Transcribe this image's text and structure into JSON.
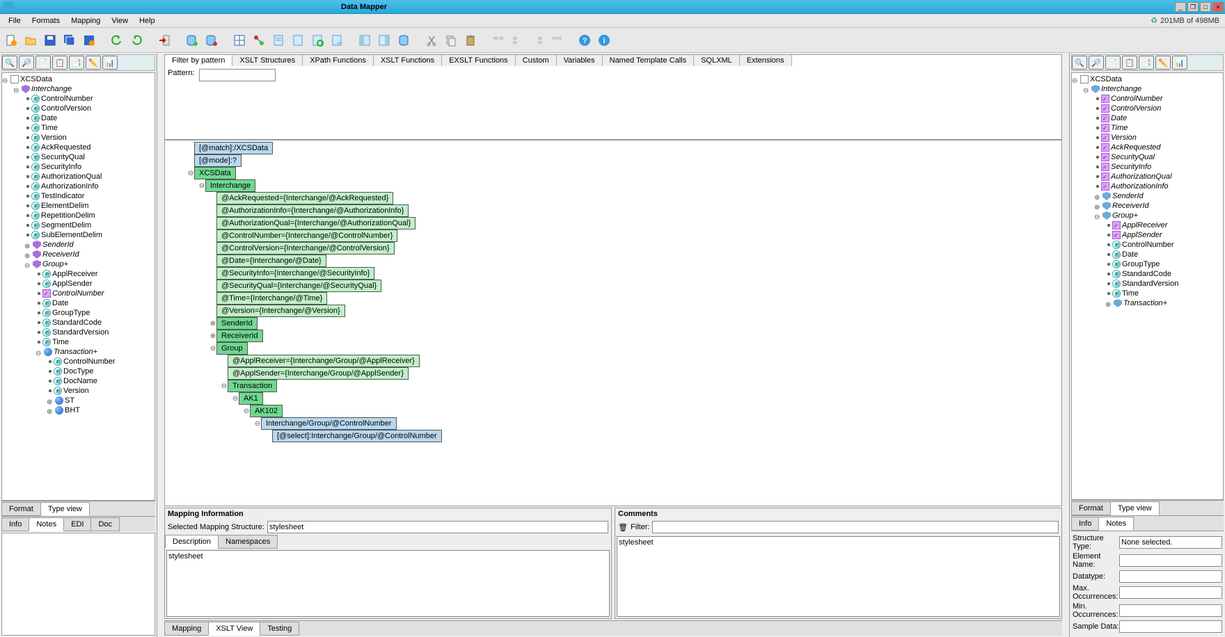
{
  "app": {
    "title": "Data Mapper",
    "memory": "201MB of 498MB"
  },
  "menu": {
    "file": "File",
    "formats": "Formats",
    "mapping": "Mapping",
    "view": "View",
    "help": "Help"
  },
  "left_tabs": {
    "format": "Format",
    "typeview": "Type view",
    "info": "Info",
    "notes": "Notes",
    "edi": "EDI",
    "doc": "Doc"
  },
  "left_tree": [
    {
      "ind": 0,
      "ex": "open",
      "ico": "doc",
      "label": "XCSData"
    },
    {
      "ind": 1,
      "ex": "open",
      "ico": "shield",
      "label": "Interchange",
      "italic": true
    },
    {
      "ind": 2,
      "ex": "dot",
      "ico": "at",
      "label": "ControlNumber"
    },
    {
      "ind": 2,
      "ex": "dot",
      "ico": "at",
      "label": "ControlVersion"
    },
    {
      "ind": 2,
      "ex": "dot",
      "ico": "at",
      "label": "Date"
    },
    {
      "ind": 2,
      "ex": "dot",
      "ico": "at",
      "label": "Time"
    },
    {
      "ind": 2,
      "ex": "dot",
      "ico": "at",
      "label": "Version"
    },
    {
      "ind": 2,
      "ex": "dot",
      "ico": "at",
      "label": "AckRequested"
    },
    {
      "ind": 2,
      "ex": "dot",
      "ico": "at",
      "label": "SecurityQual"
    },
    {
      "ind": 2,
      "ex": "dot",
      "ico": "at",
      "label": "SecurityInfo"
    },
    {
      "ind": 2,
      "ex": "dot",
      "ico": "at",
      "label": "AuthorizationQual"
    },
    {
      "ind": 2,
      "ex": "dot",
      "ico": "at",
      "label": "AuthorizationInfo"
    },
    {
      "ind": 2,
      "ex": "dot",
      "ico": "at",
      "label": "TestIndicator"
    },
    {
      "ind": 2,
      "ex": "dot",
      "ico": "at",
      "label": "ElementDelim"
    },
    {
      "ind": 2,
      "ex": "dot",
      "ico": "at",
      "label": "RepetitionDelim"
    },
    {
      "ind": 2,
      "ex": "dot",
      "ico": "at",
      "label": "SegmentDelim"
    },
    {
      "ind": 2,
      "ex": "dot",
      "ico": "at",
      "label": "SubElementDelim"
    },
    {
      "ind": 2,
      "ex": "closed",
      "ico": "shield",
      "label": "SenderId",
      "italic": true
    },
    {
      "ind": 2,
      "ex": "closed",
      "ico": "shield",
      "label": "ReceiverId",
      "italic": true
    },
    {
      "ind": 2,
      "ex": "open",
      "ico": "shield",
      "label": "Group+",
      "italic": true
    },
    {
      "ind": 3,
      "ex": "dot",
      "ico": "at",
      "label": "ApplReceiver"
    },
    {
      "ind": 3,
      "ex": "dot",
      "ico": "at",
      "label": "ApplSender"
    },
    {
      "ind": 3,
      "ex": "dot",
      "ico": "gv",
      "label": "ControlNumber",
      "italic": true
    },
    {
      "ind": 3,
      "ex": "dot",
      "ico": "at",
      "label": "Date"
    },
    {
      "ind": 3,
      "ex": "dot",
      "ico": "at",
      "label": "GroupType"
    },
    {
      "ind": 3,
      "ex": "dot",
      "ico": "at",
      "label": "StandardCode"
    },
    {
      "ind": 3,
      "ex": "dot",
      "ico": "at",
      "label": "StandardVersion"
    },
    {
      "ind": 3,
      "ex": "dot",
      "ico": "at",
      "label": "Time"
    },
    {
      "ind": 3,
      "ex": "open",
      "ico": "ball",
      "label": "Transaction+",
      "italic": true
    },
    {
      "ind": 4,
      "ex": "dot",
      "ico": "at",
      "label": "ControlNumber"
    },
    {
      "ind": 4,
      "ex": "dot",
      "ico": "at",
      "label": "DocType"
    },
    {
      "ind": 4,
      "ex": "dot",
      "ico": "at",
      "label": "DocName"
    },
    {
      "ind": 4,
      "ex": "dot",
      "ico": "at",
      "label": "Version"
    },
    {
      "ind": 4,
      "ex": "closed",
      "ico": "ball",
      "label": "ST"
    },
    {
      "ind": 4,
      "ex": "closed",
      "ico": "ball",
      "label": "BHT"
    }
  ],
  "center": {
    "filter_tabs": [
      "Filter by pattern",
      "XSLT Structures",
      "XPath Functions",
      "XSLT Functions",
      "EXSLT Functions",
      "Custom",
      "Variables",
      "Named Template Calls",
      "SQLXML",
      "Extensions"
    ],
    "pattern_label": "Pattern:",
    "map_rows": [
      {
        "ind": 2,
        "ex": "",
        "cls": "c-blue",
        "label": "[@match]:/XCSData"
      },
      {
        "ind": 2,
        "ex": "",
        "cls": "c-blue",
        "label": "[@mode]:?"
      },
      {
        "ind": 2,
        "ex": "open",
        "cls": "c-green",
        "label": "XCSData"
      },
      {
        "ind": 3,
        "ex": "open",
        "cls": "c-green",
        "label": "Interchange"
      },
      {
        "ind": 4,
        "ex": "",
        "cls": "c-lgreen",
        "label": "@AckRequested={Interchange/@AckRequested}"
      },
      {
        "ind": 4,
        "ex": "",
        "cls": "c-lgreen",
        "label": "@AuthorizationInfo={Interchange/@AuthorizationInfo}"
      },
      {
        "ind": 4,
        "ex": "",
        "cls": "c-lgreen",
        "label": "@AuthorizationQual={Interchange/@AuthorizationQual}"
      },
      {
        "ind": 4,
        "ex": "",
        "cls": "c-lgreen",
        "label": "@ControlNumber={Interchange/@ControlNumber}"
      },
      {
        "ind": 4,
        "ex": "",
        "cls": "c-lgreen",
        "label": "@ControlVersion={Interchange/@ControlVersion}"
      },
      {
        "ind": 4,
        "ex": "",
        "cls": "c-lgreen",
        "label": "@Date={Interchange/@Date}"
      },
      {
        "ind": 4,
        "ex": "",
        "cls": "c-lgreen",
        "label": "@SecurityInfo={Interchange/@SecurityInfo}"
      },
      {
        "ind": 4,
        "ex": "",
        "cls": "c-lgreen",
        "label": "@SecurityQual={Interchange/@SecurityQual}"
      },
      {
        "ind": 4,
        "ex": "",
        "cls": "c-lgreen",
        "label": "@Time={Interchange/@Time}"
      },
      {
        "ind": 4,
        "ex": "",
        "cls": "c-lgreen",
        "label": "@Version={Interchange/@Version}"
      },
      {
        "ind": 4,
        "ex": "closed",
        "cls": "c-green",
        "label": "SenderId"
      },
      {
        "ind": 4,
        "ex": "closed",
        "cls": "c-green",
        "label": "ReceiverId"
      },
      {
        "ind": 4,
        "ex": "open",
        "cls": "c-green",
        "label": "Group"
      },
      {
        "ind": 5,
        "ex": "",
        "cls": "c-lgreen",
        "label": "@ApplReceiver={Interchange/Group/@ApplReceiver}"
      },
      {
        "ind": 5,
        "ex": "",
        "cls": "c-lgreen",
        "label": "@ApplSender={Interchange/Group/@ApplSender}"
      },
      {
        "ind": 5,
        "ex": "open",
        "cls": "c-green",
        "label": "Transaction"
      },
      {
        "ind": 6,
        "ex": "open",
        "cls": "c-green",
        "label": "AK1"
      },
      {
        "ind": 7,
        "ex": "open",
        "cls": "c-green",
        "label": "AK102"
      },
      {
        "ind": 8,
        "ex": "open",
        "cls": "c-blue",
        "label": "Interchange/Group/@ControlNumber"
      },
      {
        "ind": 9,
        "ex": "",
        "cls": "c-blue",
        "label": "[@select]:Interchange/Group/@ControlNumber"
      }
    ],
    "mapping_info": {
      "title": "Mapping Information",
      "selected_label": "Selected Mapping Structure:",
      "selected_value": "stylesheet",
      "tabs": [
        "Description",
        "Namespaces"
      ],
      "desc": "stylesheet"
    },
    "comments": {
      "title": "Comments",
      "filter_label": "Filter:",
      "body": "stylesheet"
    },
    "bottom_tabs": [
      "Mapping",
      "XSLT View",
      "Testing"
    ]
  },
  "right_tabs": {
    "format": "Format",
    "typeview": "Type view",
    "info": "Info",
    "notes": "Notes"
  },
  "right_tree": [
    {
      "ind": 0,
      "ex": "open",
      "ico": "doc",
      "label": "XCSData"
    },
    {
      "ind": 1,
      "ex": "open",
      "ico": "shield-o",
      "label": "Interchange",
      "italic": true
    },
    {
      "ind": 2,
      "ex": "dot",
      "ico": "gv",
      "label": "ControlNumber",
      "italic": true
    },
    {
      "ind": 2,
      "ex": "dot",
      "ico": "gv",
      "label": "ControlVersion",
      "italic": true
    },
    {
      "ind": 2,
      "ex": "dot",
      "ico": "gv",
      "label": "Date",
      "italic": true
    },
    {
      "ind": 2,
      "ex": "dot",
      "ico": "gv",
      "label": "Time",
      "italic": true
    },
    {
      "ind": 2,
      "ex": "dot",
      "ico": "gv",
      "label": "Version",
      "italic": true
    },
    {
      "ind": 2,
      "ex": "dot",
      "ico": "gv",
      "label": "AckRequested",
      "italic": true
    },
    {
      "ind": 2,
      "ex": "dot",
      "ico": "gv",
      "label": "SecurityQual",
      "italic": true
    },
    {
      "ind": 2,
      "ex": "dot",
      "ico": "gv",
      "label": "SecurityInfo",
      "italic": true
    },
    {
      "ind": 2,
      "ex": "dot",
      "ico": "gv",
      "label": "AuthorizationQual",
      "italic": true
    },
    {
      "ind": 2,
      "ex": "dot",
      "ico": "gv",
      "label": "AuthorizationInfo",
      "italic": true
    },
    {
      "ind": 2,
      "ex": "closed",
      "ico": "shield-o",
      "label": "SenderId",
      "italic": true
    },
    {
      "ind": 2,
      "ex": "closed",
      "ico": "shield-o",
      "label": "ReceiverId",
      "italic": true
    },
    {
      "ind": 2,
      "ex": "open",
      "ico": "shield-o",
      "label": "Group+",
      "italic": true
    },
    {
      "ind": 3,
      "ex": "dot",
      "ico": "gv",
      "label": "ApplReceiver",
      "italic": true
    },
    {
      "ind": 3,
      "ex": "dot",
      "ico": "gv",
      "label": "ApplSender",
      "italic": true
    },
    {
      "ind": 3,
      "ex": "dot",
      "ico": "at",
      "label": "ControlNumber"
    },
    {
      "ind": 3,
      "ex": "dot",
      "ico": "at",
      "label": "Date"
    },
    {
      "ind": 3,
      "ex": "dot",
      "ico": "at",
      "label": "GroupType"
    },
    {
      "ind": 3,
      "ex": "dot",
      "ico": "at",
      "label": "StandardCode"
    },
    {
      "ind": 3,
      "ex": "dot",
      "ico": "at",
      "label": "StandardVersion"
    },
    {
      "ind": 3,
      "ex": "dot",
      "ico": "at",
      "label": "Time"
    },
    {
      "ind": 3,
      "ex": "closed",
      "ico": "shield-o",
      "label": "Transaction+",
      "italic": true
    }
  ],
  "struct": {
    "type_label": "Structure Type:",
    "type_value": "None selected.",
    "name_label": "Element Name:",
    "name_value": "",
    "dtype_label": "Datatype:",
    "dtype_value": "",
    "max_label": "Max. Occurrences:",
    "max_value": "",
    "min_label": "Min. Occurrences:",
    "min_value": "",
    "sample_label": "Sample Data:",
    "sample_value": ""
  }
}
